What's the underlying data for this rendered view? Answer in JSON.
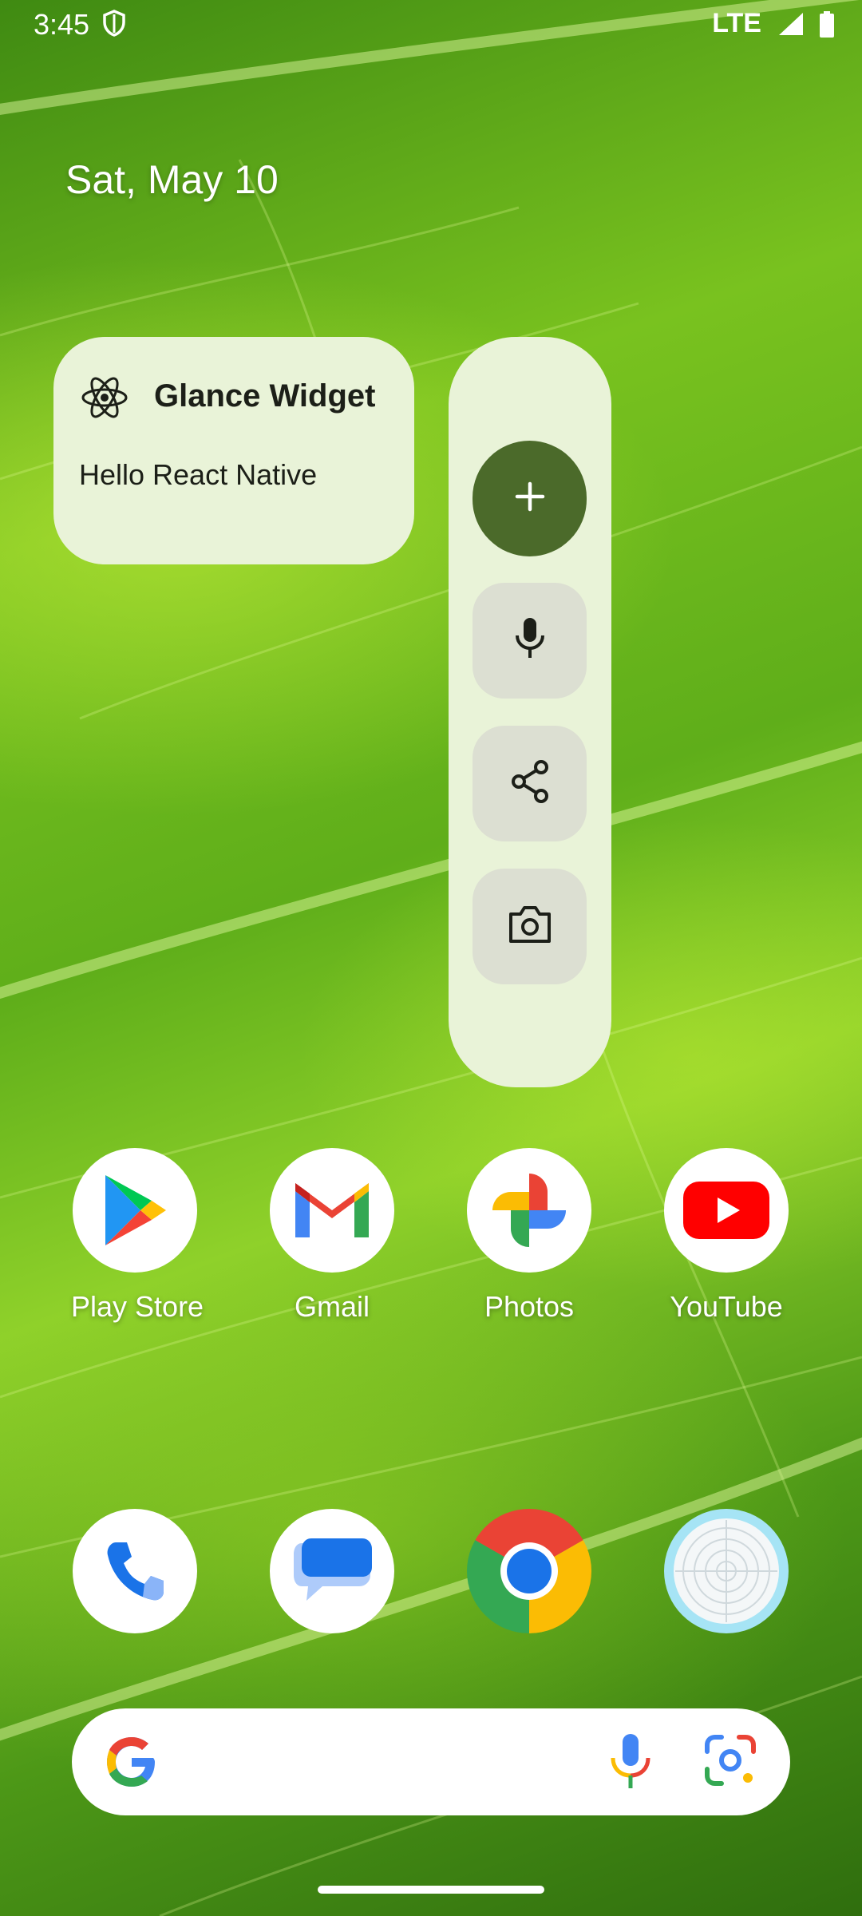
{
  "status_bar": {
    "time": "3:45",
    "network": "LTE"
  },
  "date": "Sat, May 10",
  "glance_widget": {
    "title": "Glance Widget",
    "body": "Hello React Native"
  },
  "action_panel": {
    "buttons": [
      "add-icon",
      "mic-icon",
      "share-icon",
      "camera-icon"
    ]
  },
  "apps": [
    {
      "label": "Play Store"
    },
    {
      "label": "Gmail"
    },
    {
      "label": "Photos"
    },
    {
      "label": "YouTube"
    }
  ],
  "dock": [
    "phone-icon",
    "messages-icon",
    "chrome-icon",
    "radar-app-icon"
  ],
  "colors": {
    "widget_bg": "#e9f3d8",
    "add_button": "#4b6a2a",
    "panel_button": "#dcdfd2"
  }
}
